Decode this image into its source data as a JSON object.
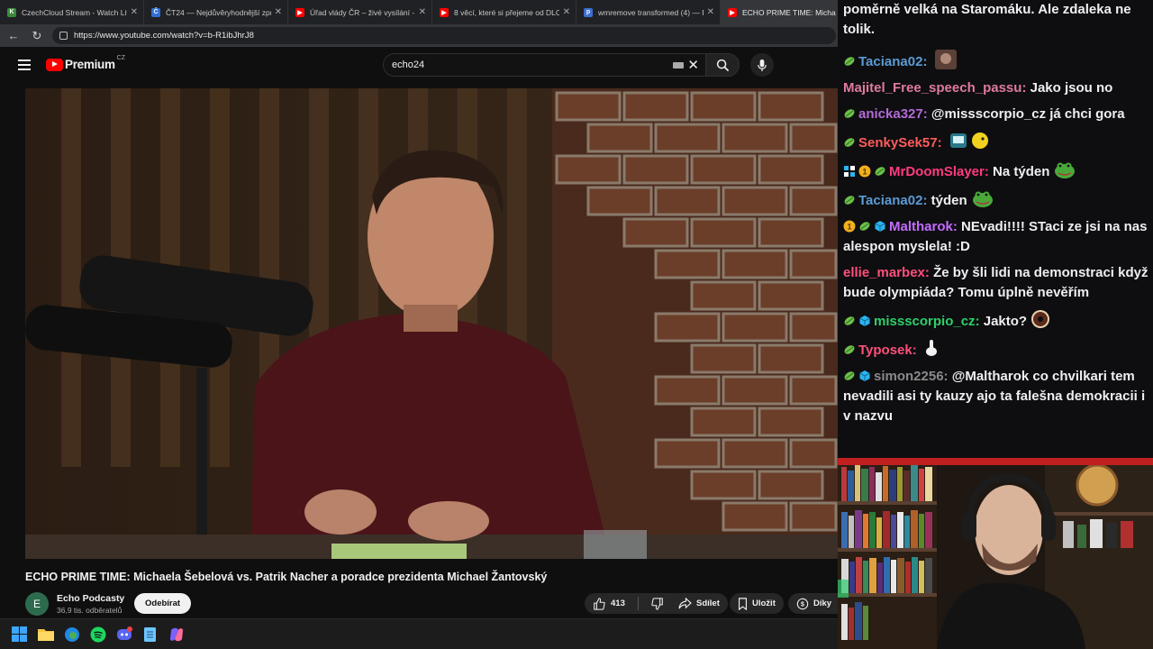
{
  "browser": {
    "tabs": [
      {
        "title": "CzechCloud Stream - Watch Live o",
        "favicon_color": "#3a8a3a",
        "favicon_char": "K"
      },
      {
        "title": "ČT24 — Nejdůvěryhodnější zpravo",
        "favicon_color": "#2f6fd6",
        "favicon_char": "Č"
      },
      {
        "title": "Úřad vlády ČR – živé vysílání - You",
        "favicon_color": "#ff0000",
        "favicon_char": "▶"
      },
      {
        "title": "8 věcí, které si přejeme od DLC pro",
        "favicon_color": "#ff0000",
        "favicon_char": "▶"
      },
      {
        "title": "wmremove transformed (4) — Por",
        "favicon_color": "#3b6fd1",
        "favicon_char": "p"
      },
      {
        "title": "ECHO PRIME TIME: Micha",
        "favicon_color": "#ff0000",
        "favicon_char": "▶"
      }
    ],
    "url": "https://www.youtube.com/watch?v=b-R1ibJhrJ8"
  },
  "youtube": {
    "logo_word": "Premium",
    "logo_region": "CZ",
    "search_value": "echo24",
    "video_title": "ECHO PRIME TIME: Michaela Šebelová vs. Patrik Nacher a poradce prezidenta Michael Žantovský",
    "channel": {
      "initial": "E",
      "name": "Echo Podcasty",
      "subs": "36,9 tis. odběratelů"
    },
    "subscribe_label": "Odebírat",
    "likes": "413",
    "share_label": "Sdílet",
    "save_label": "Uložit",
    "thanks_label": "Díky"
  },
  "chat": {
    "intro": "poměrně velká na Staromáku. Ale zdaleka ne tolik.",
    "messages": [
      {
        "user": "Taciana02",
        "color": "#5b9bd5",
        "text": "",
        "badges": [
          "sub"
        ],
        "emote": "face"
      },
      {
        "user": "Majitel_Free_speech_passu",
        "color": "#e07aa0",
        "text": "Jako jsou no",
        "badges": [],
        "emote": ""
      },
      {
        "user": "anicka327",
        "color": "#b36bd6",
        "text": "@missscorpio_cz já chci gora",
        "badges": [
          "sub"
        ],
        "emote": ""
      },
      {
        "user": "SenkySek57",
        "color": "#ff5c5c",
        "text": "",
        "badges": [
          "sub"
        ],
        "emote": "fish"
      },
      {
        "user": "MrDoomSlayer",
        "color": "#ff3b7f",
        "text": "Na týden",
        "badges": [
          "grid",
          "coin",
          "sub"
        ],
        "emote": "frog"
      },
      {
        "user": "Taciana02",
        "color": "#5b9bd5",
        "text": "týden",
        "badges": [
          "sub"
        ],
        "emote": "frog"
      },
      {
        "user": "Maltharok",
        "color": "#c56bff",
        "text": "NEvadi!!!! STaci ze jsi na nas alespon myslela! :D",
        "badges": [
          "coin",
          "sub",
          "cube"
        ],
        "emote": ""
      },
      {
        "user": "ellie_marbex",
        "color": "#ff4f7b",
        "text": "Že by šli lidi na demonstraci když bude olympiáda? Tomu úplně nevěřím",
        "badges": [],
        "emote": ""
      },
      {
        "user": "missscorpio_cz",
        "color": "#2ecf6b",
        "text": "Jakto?",
        "badges": [
          "sub",
          "cube"
        ],
        "emote": "donut"
      },
      {
        "user": "Typosek",
        "color": "#ff4f7b",
        "text": "",
        "badges": [
          "sub"
        ],
        "emote": "hand"
      },
      {
        "user": "simon2256",
        "color": "#8a8a8a",
        "text": "@Maltharok co chvilkari tem nevadili asi ty kauzy ajo ta falešna demokracii i v nazvu",
        "badges": [
          "sub",
          "cube"
        ],
        "emote": ""
      }
    ]
  }
}
